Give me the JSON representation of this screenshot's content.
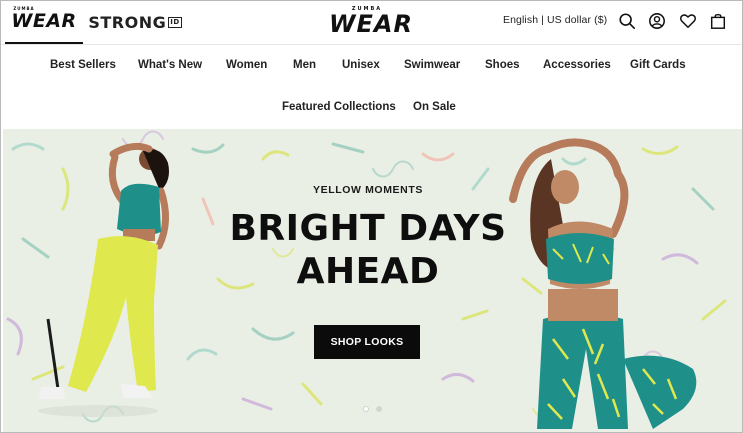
{
  "header": {
    "brand_tabs": [
      {
        "label": "WEAR",
        "sub": "ZUMBA",
        "active": true
      },
      {
        "label": "STRONG",
        "badge": "ID",
        "active": false
      }
    ],
    "center_logo": {
      "sub": "ZUMBA",
      "label": "WEAR"
    },
    "locale": "English | US dollar ($)",
    "icons": [
      "search-icon",
      "account-icon",
      "wishlist-heart-icon",
      "shopping-bag-icon"
    ]
  },
  "nav": {
    "row1": [
      "Best Sellers",
      "What's New",
      "Women",
      "Men",
      "Unisex",
      "Swimwear",
      "Shoes",
      "Accessories",
      "Gift Cards"
    ],
    "row2": [
      "Featured Collections",
      "On Sale"
    ]
  },
  "hero": {
    "eyebrow": "YELLOW MOMENTS",
    "headline_line1": "BRIGHT DAYS",
    "headline_line2": "AHEAD",
    "cta": "SHOP LOOKS",
    "carousel": {
      "slides": 2,
      "active": 1
    }
  },
  "colors": {
    "text": "#111111",
    "cta_bg": "#0b0b0b",
    "hero_bg": "#e9eee5",
    "accent_yellow": "#dde94a",
    "accent_teal": "#1f8f8a"
  }
}
